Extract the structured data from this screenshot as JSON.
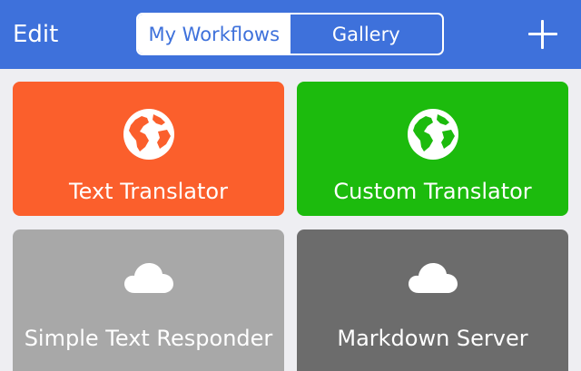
{
  "nav": {
    "edit_label": "Edit",
    "tabs": [
      {
        "label": "My Workflows",
        "selected": true
      },
      {
        "label": "Gallery",
        "selected": false
      }
    ],
    "add_icon": "plus-icon"
  },
  "workflows": [
    {
      "title": "Text Translator",
      "icon": "globe-icon",
      "color": "#fb5f2c"
    },
    {
      "title": "Custom Translator",
      "icon": "globe-icon",
      "color": "#1cbb0d"
    },
    {
      "title": "Simple Text Responder",
      "icon": "cloud-icon",
      "color": "#a8a8a8"
    },
    {
      "title": "Markdown Server",
      "icon": "cloud-icon",
      "color": "#6c6c6c"
    }
  ],
  "colors": {
    "accent": "#3e71db",
    "background": "#eeeef2"
  }
}
